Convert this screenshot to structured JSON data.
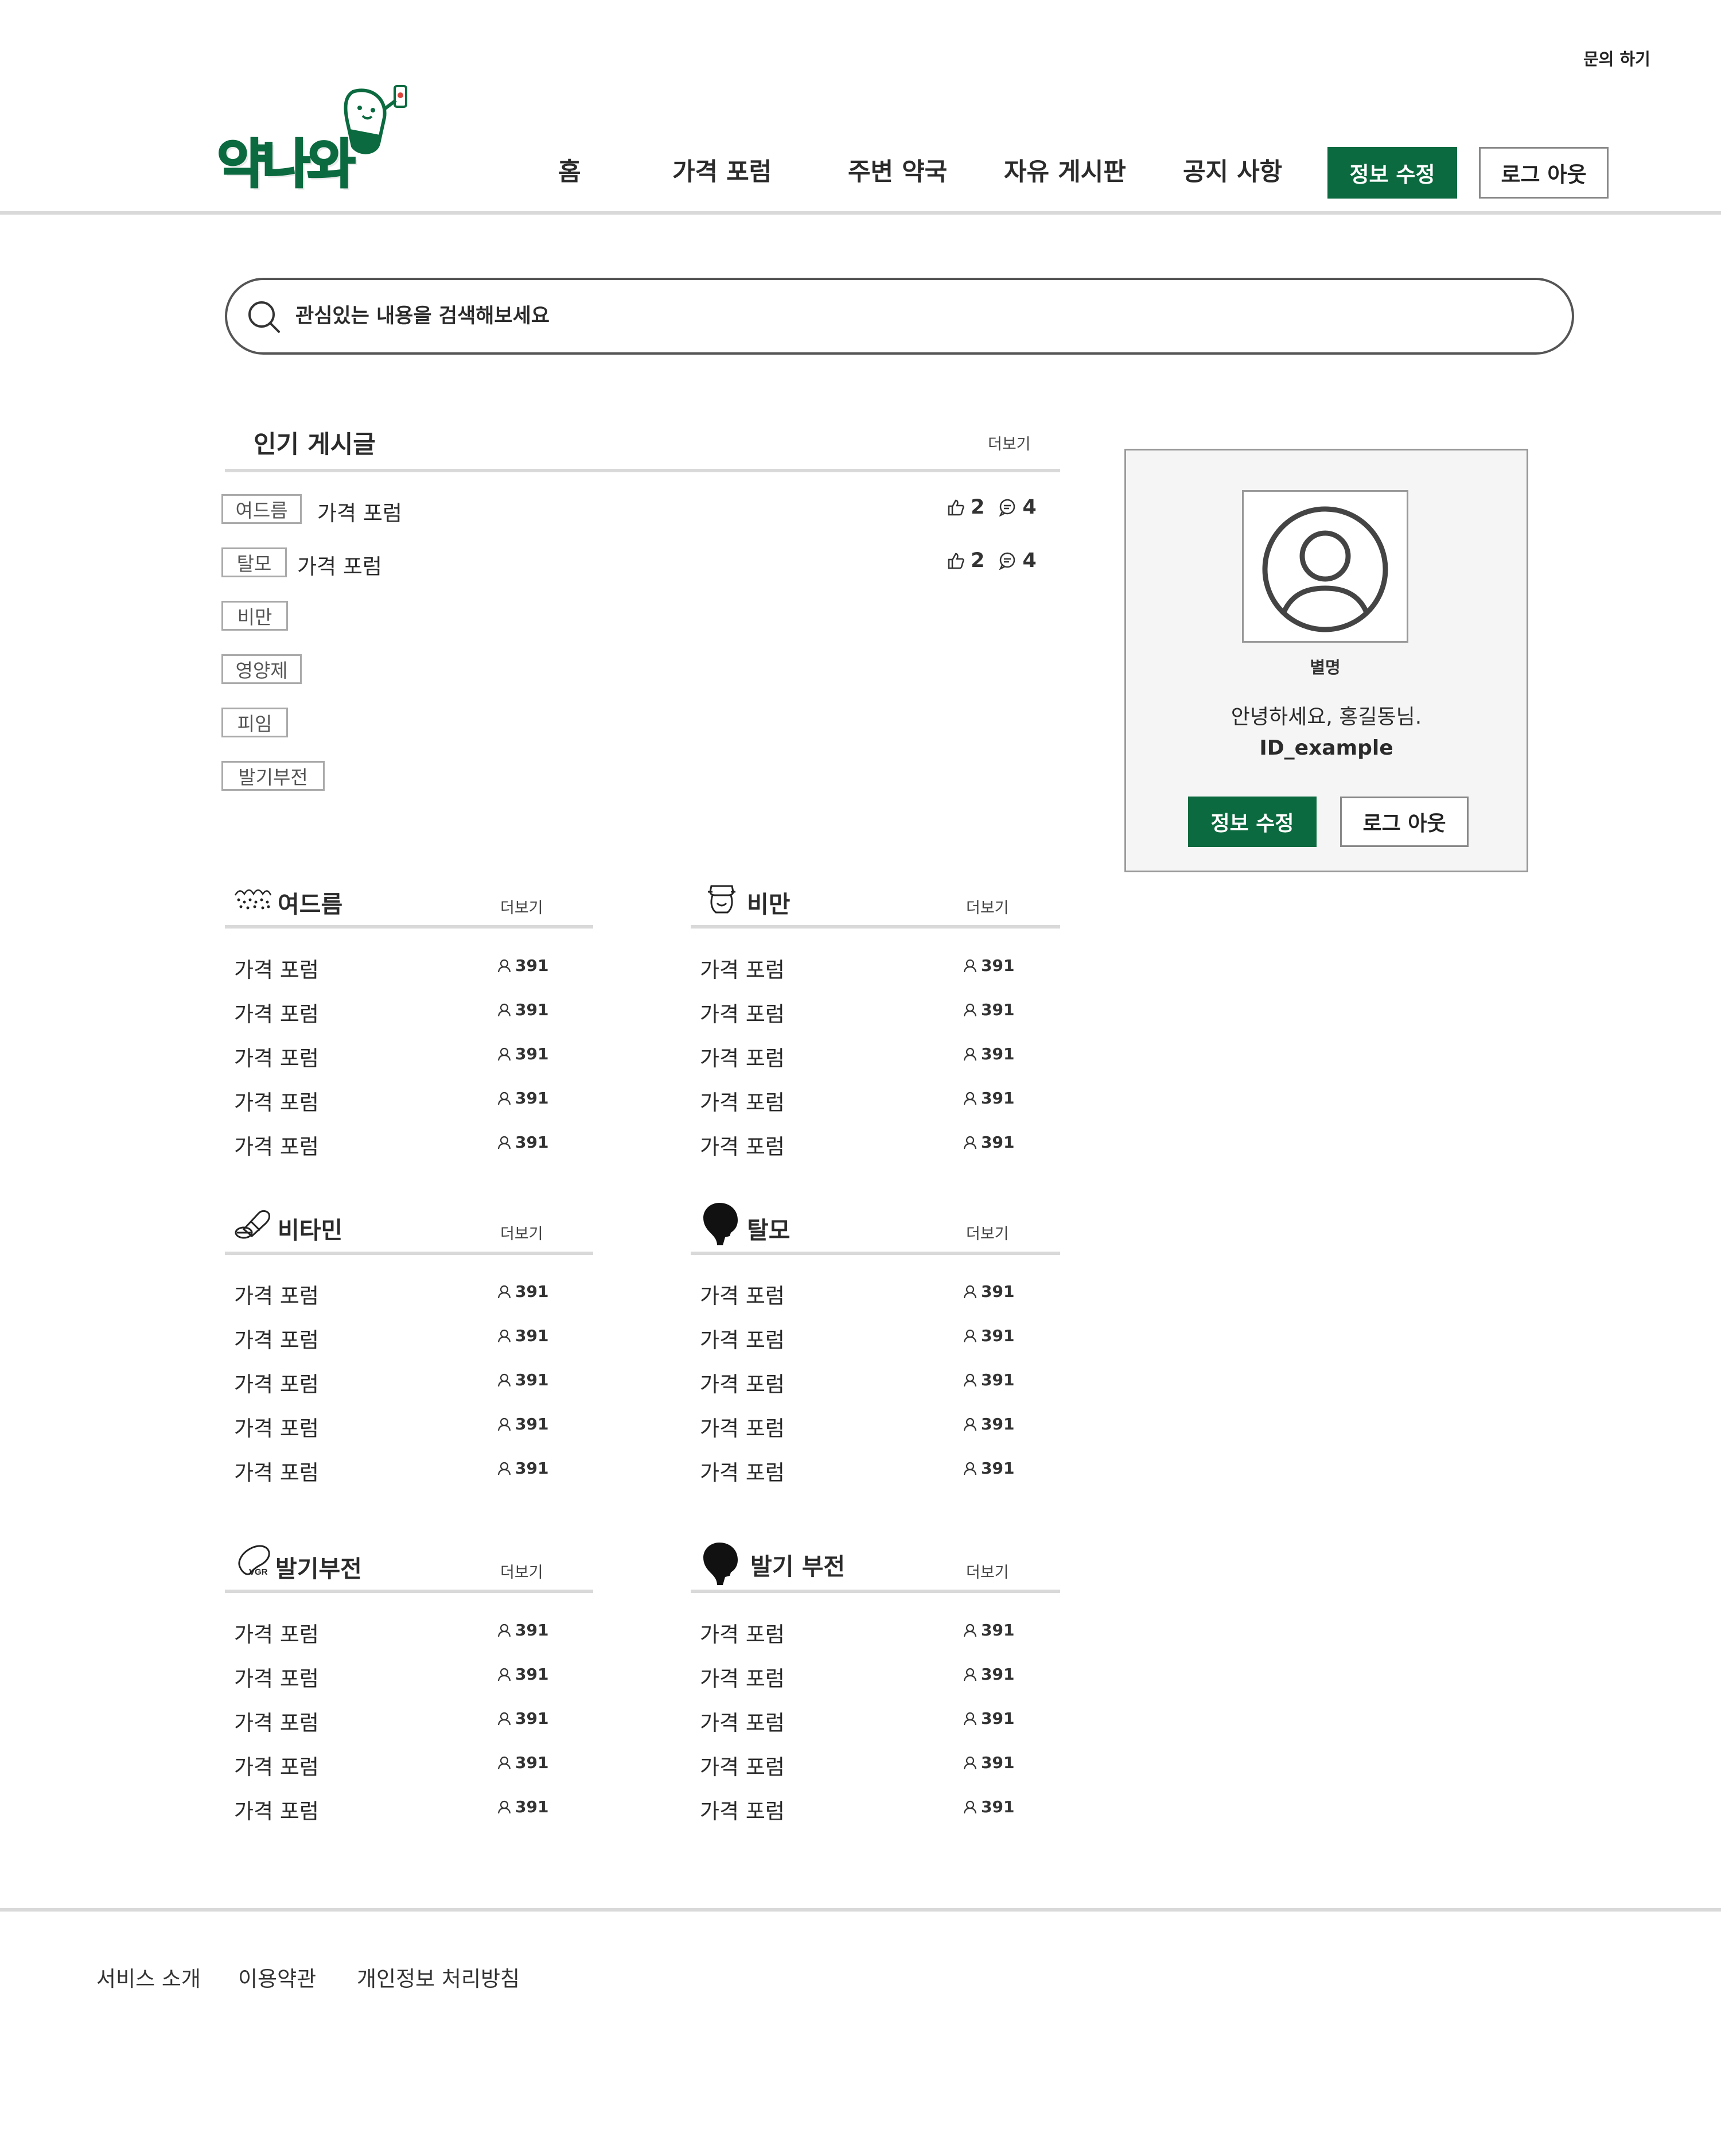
{
  "header": {
    "contact_label": "문의 하기",
    "logo_text": "약나와",
    "nav": [
      "홈",
      "가격 포럼",
      "주변 약국",
      "자유 게시판",
      "공지 사항"
    ],
    "edit_button": "정보 수정",
    "logout_button": "로그 아웃"
  },
  "colors": {
    "brand_green": "#0b6a3f",
    "divider": "#d9d9d9",
    "text": "#2b2b2b"
  },
  "search": {
    "placeholder": "관심있는 내용을 검색해보세요",
    "icon": "search-icon"
  },
  "popular": {
    "title": "인기 게시글",
    "more": "더보기",
    "tags": [
      "여드름",
      "탈모",
      "비만",
      "영양제",
      "피임",
      "발기부전"
    ],
    "posts": [
      {
        "tag": "여드름",
        "title": "가격 포럼",
        "likes": "2",
        "comments": "4"
      },
      {
        "tag": "탈모",
        "title": "가격 포럼",
        "likes": "2",
        "comments": "4"
      }
    ]
  },
  "profile": {
    "nickname": "별명",
    "greeting": "안녕하세요, 홍길동님.",
    "user_id": "ID_example",
    "edit_button": "정보 수정",
    "logout_button": "로그 아웃"
  },
  "categories": [
    {
      "title": "여드름",
      "icon": "acne-icon",
      "more": "더보기",
      "rows": [
        {
          "title": "가격 포럼",
          "count": "391"
        },
        {
          "title": "가격 포럼",
          "count": "391"
        },
        {
          "title": "가격 포럼",
          "count": "391"
        },
        {
          "title": "가격 포럼",
          "count": "391"
        },
        {
          "title": "가격 포럼",
          "count": "391"
        }
      ]
    },
    {
      "title": "비만",
      "icon": "obesity-icon",
      "more": "더보기",
      "rows": [
        {
          "title": "가격 포럼",
          "count": "391"
        },
        {
          "title": "가격 포럼",
          "count": "391"
        },
        {
          "title": "가격 포럼",
          "count": "391"
        },
        {
          "title": "가격 포럼",
          "count": "391"
        },
        {
          "title": "가격 포럼",
          "count": "391"
        }
      ]
    },
    {
      "title": "비타민",
      "icon": "vitamin-pill-icon",
      "more": "더보기",
      "rows": [
        {
          "title": "가격 포럼",
          "count": "391"
        },
        {
          "title": "가격 포럼",
          "count": "391"
        },
        {
          "title": "가격 포럼",
          "count": "391"
        },
        {
          "title": "가격 포럼",
          "count": "391"
        },
        {
          "title": "가격 포럼",
          "count": "391"
        }
      ]
    },
    {
      "title": "탈모",
      "icon": "head-silhouette-icon",
      "more": "더보기",
      "rows": [
        {
          "title": "가격 포럼",
          "count": "391"
        },
        {
          "title": "가격 포럼",
          "count": "391"
        },
        {
          "title": "가격 포럼",
          "count": "391"
        },
        {
          "title": "가격 포럼",
          "count": "391"
        },
        {
          "title": "가격 포럼",
          "count": "391"
        }
      ]
    },
    {
      "title": "발기부전",
      "icon": "vgr-pill-icon",
      "more": "더보기",
      "rows": [
        {
          "title": "가격 포럼",
          "count": "391"
        },
        {
          "title": "가격 포럼",
          "count": "391"
        },
        {
          "title": "가격 포럼",
          "count": "391"
        },
        {
          "title": "가격 포럼",
          "count": "391"
        },
        {
          "title": "가격 포럼",
          "count": "391"
        }
      ]
    },
    {
      "title": "발기 부전",
      "icon": "head-silhouette-icon",
      "more": "더보기",
      "rows": [
        {
          "title": "가격 포럼",
          "count": "391"
        },
        {
          "title": "가격 포럼",
          "count": "391"
        },
        {
          "title": "가격 포럼",
          "count": "391"
        },
        {
          "title": "가격 포럼",
          "count": "391"
        },
        {
          "title": "가격 포럼",
          "count": "391"
        }
      ]
    }
  ],
  "footer": {
    "links": [
      "서비스 소개",
      "이용약관",
      "개인정보 처리방침"
    ]
  }
}
